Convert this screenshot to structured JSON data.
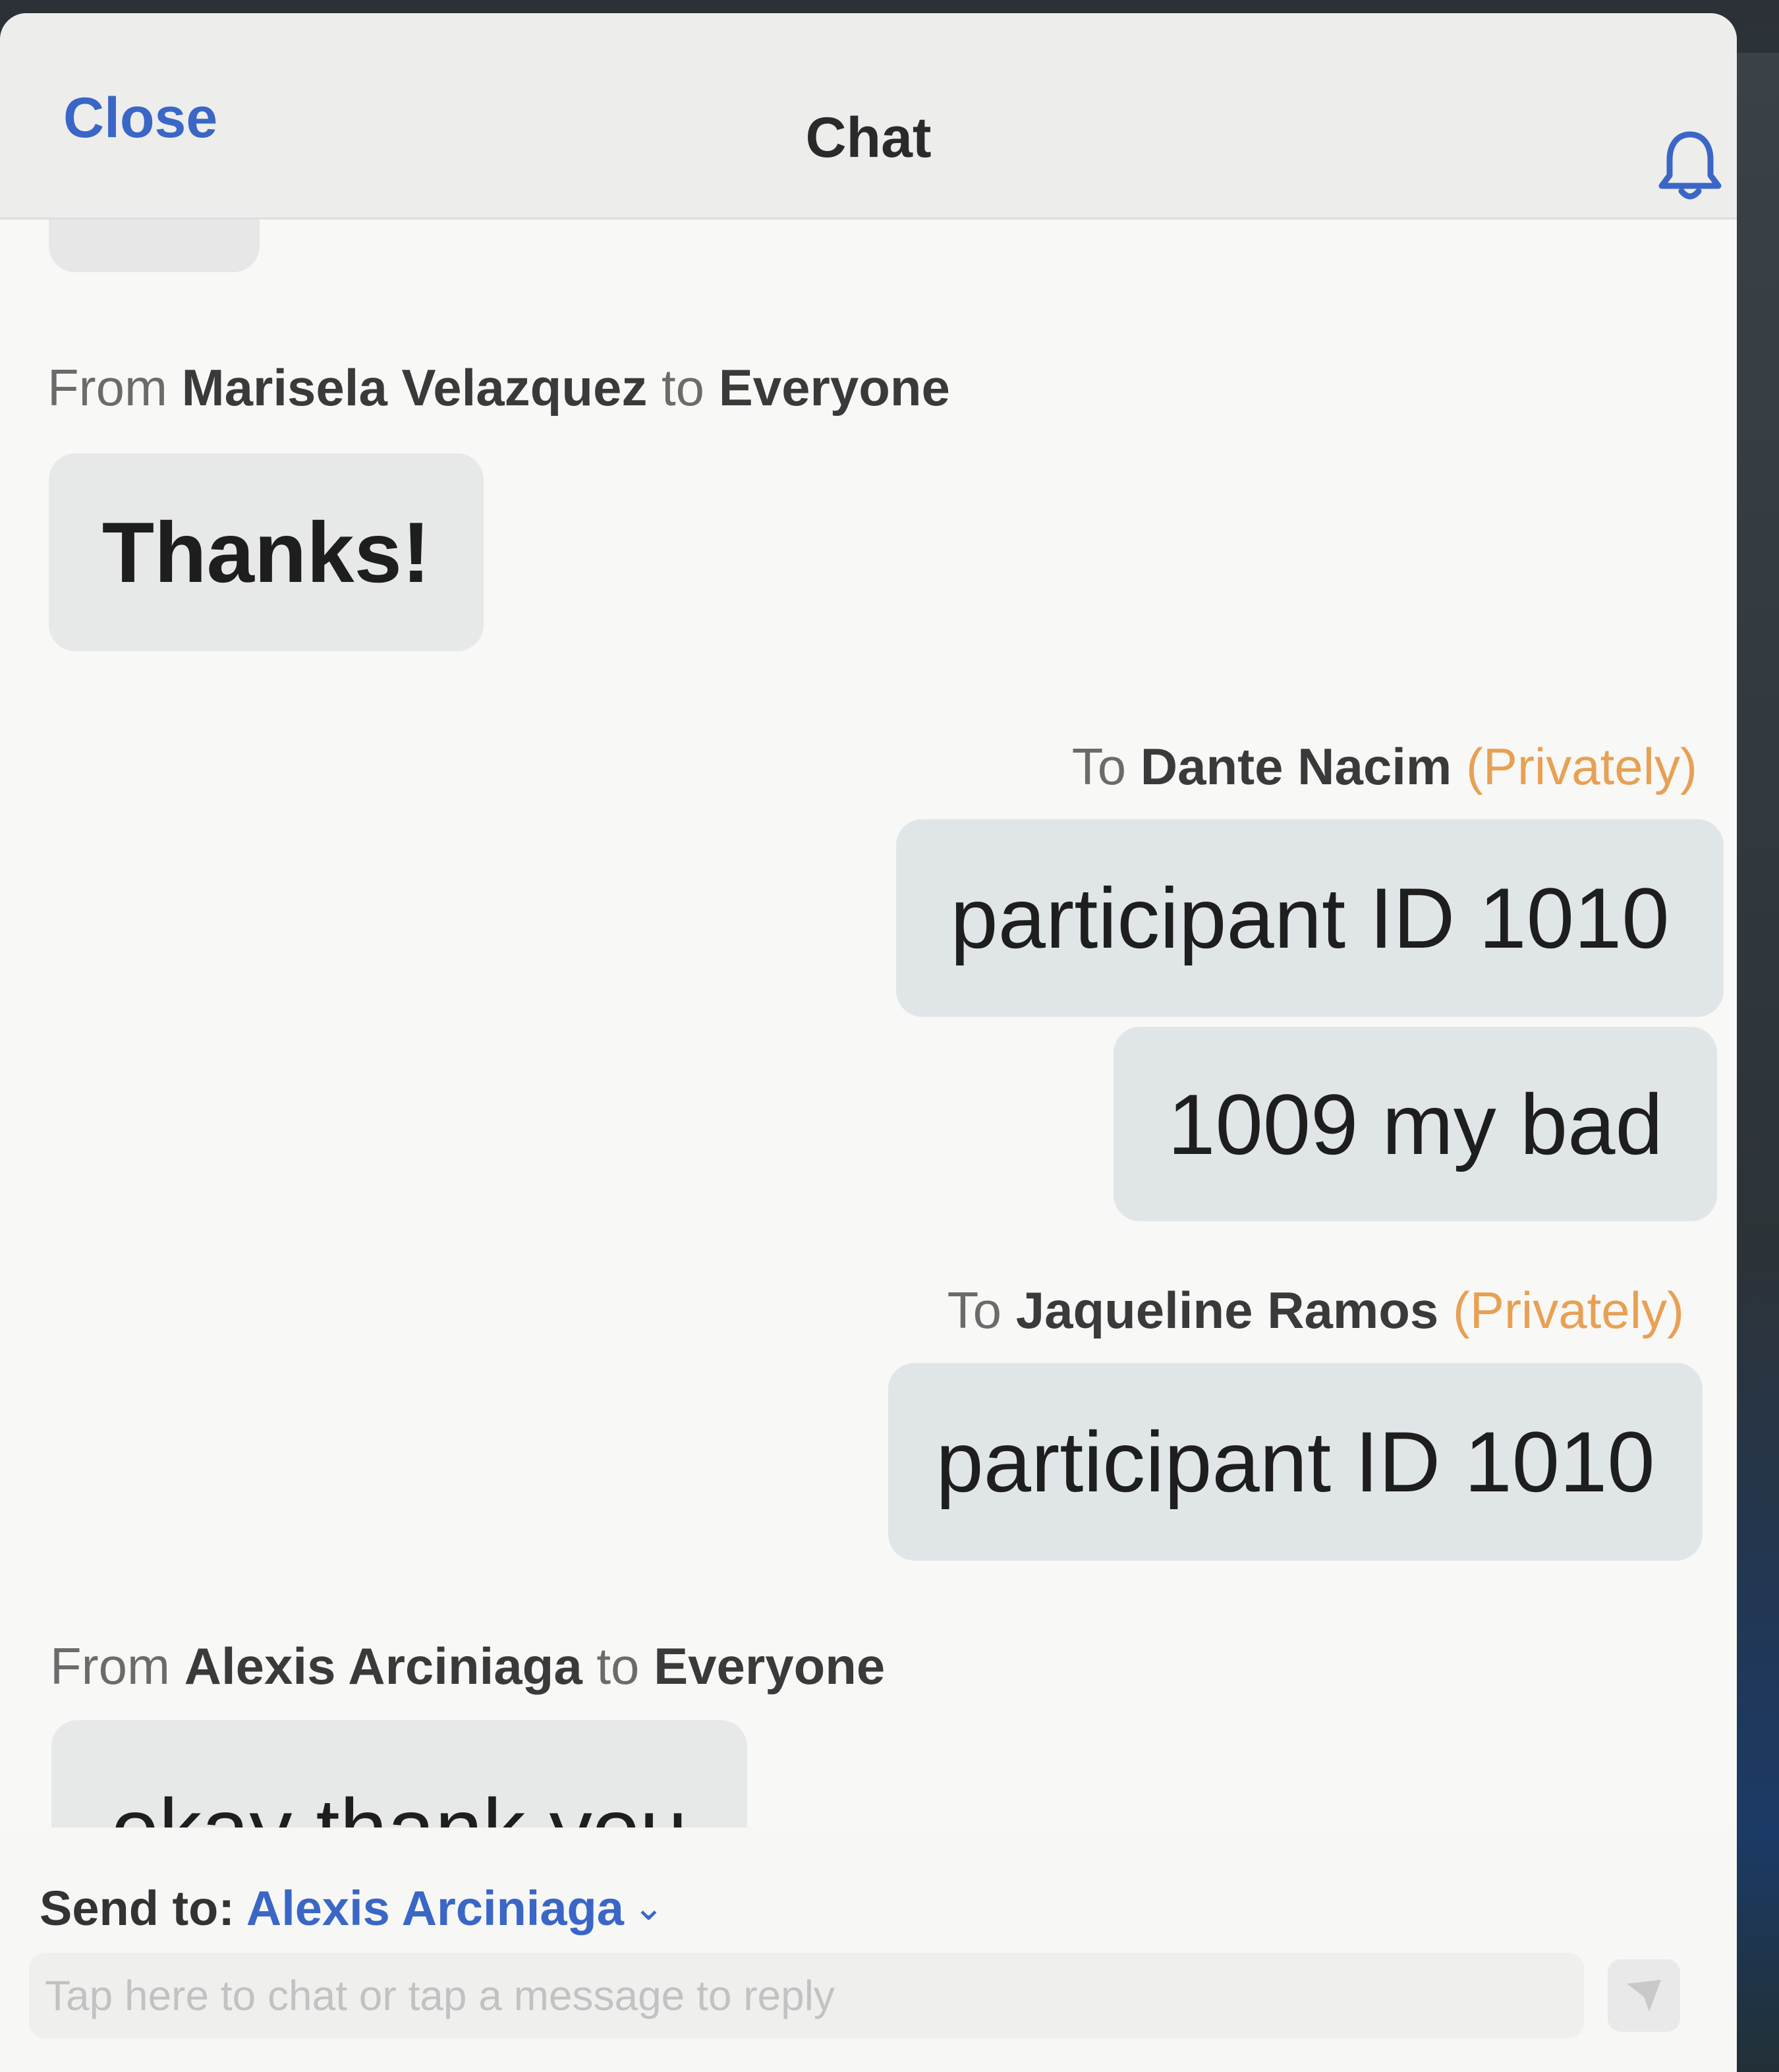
{
  "header": {
    "close_label": "Close",
    "title": "Chat",
    "bell_icon": "bell-icon"
  },
  "messages": [
    {
      "meta_prefix": "From ",
      "name": "Marisela Velazquez",
      "meta_mid": " to ",
      "target": "Everyone",
      "text": "Thanks!"
    },
    {
      "meta_prefix": "To ",
      "name": "Dante Nacim",
      "privacy": "(Privately)",
      "texts": [
        "participant ID 1010",
        "1009 my bad"
      ]
    },
    {
      "meta_prefix": "To ",
      "name": "Jaqueline Ramos",
      "privacy": "(Privately)",
      "text": "participant ID 1010"
    },
    {
      "meta_prefix": "From ",
      "name": "Alexis Arciniaga",
      "meta_mid": " to ",
      "target": "Everyone",
      "text": "okay thank you"
    }
  ],
  "composer": {
    "send_to_label": "Send to: ",
    "send_to_target": "Alexis Arciniaga",
    "placeholder": "Tap here to chat or tap a message to reply",
    "send_icon": "send-icon"
  },
  "colors": {
    "accent": "#3a66c6",
    "private": "#e8a054"
  }
}
